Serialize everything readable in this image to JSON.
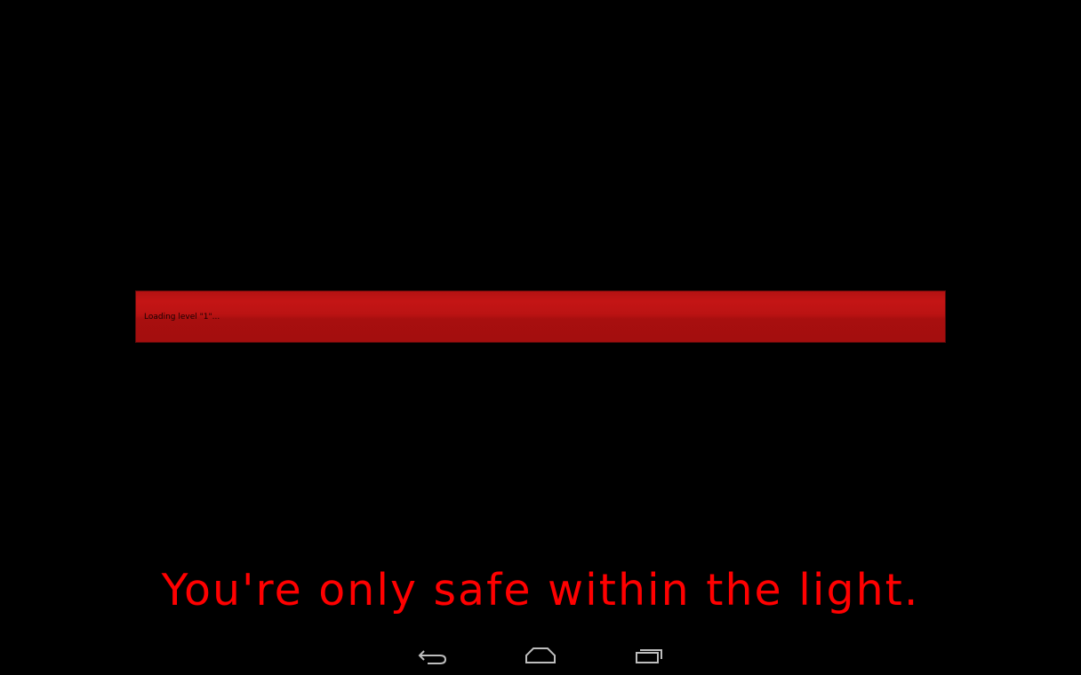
{
  "loading": {
    "text": "Loading level \"1\"..."
  },
  "tagline": "You're only safe within the light.",
  "navbar": {
    "back_icon": "back-arrow-icon",
    "home_icon": "home-icon",
    "recent_icon": "recent-apps-icon"
  },
  "colors": {
    "background": "#000000",
    "accent": "#ff0000",
    "bar": "#b31212"
  }
}
